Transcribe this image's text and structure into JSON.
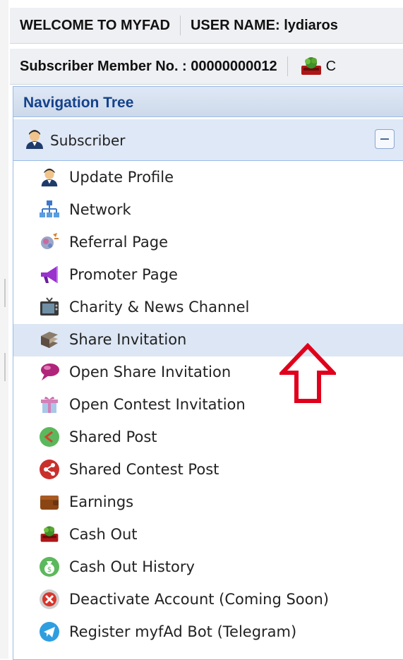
{
  "header": {
    "welcome": "WELCOME TO MYFAD",
    "username_label": "USER NAME: lydiaros",
    "subscriber_no": "Subscriber Member No. : 00000000012",
    "truncated_text": "C"
  },
  "navigation": {
    "title": "Navigation Tree",
    "root": {
      "label": "Subscriber",
      "icon": "user-icon"
    },
    "selected_item": "Share Invitation",
    "items": [
      {
        "label": "Update Profile",
        "icon": "user-icon"
      },
      {
        "label": "Network",
        "icon": "network-icon"
      },
      {
        "label": "Referral Page",
        "icon": "referral-icon"
      },
      {
        "label": "Promoter Page",
        "icon": "megaphone-icon"
      },
      {
        "label": "Charity & News Channel",
        "icon": "tv-icon"
      },
      {
        "label": "Share Invitation",
        "icon": "book-stack-icon"
      },
      {
        "label": "Open Share Invitation",
        "icon": "speech-bubble-icon"
      },
      {
        "label": "Open Contest Invitation",
        "icon": "gift-icon"
      },
      {
        "label": "Shared Post",
        "icon": "share-green-icon"
      },
      {
        "label": "Shared Contest Post",
        "icon": "share-red-icon"
      },
      {
        "label": "Earnings",
        "icon": "wallet-icon"
      },
      {
        "label": "Cash Out",
        "icon": "cash-tray-icon"
      },
      {
        "label": "Cash Out History",
        "icon": "money-bag-icon"
      },
      {
        "label": "Deactivate Account (Coming Soon)",
        "icon": "close-circle-icon"
      },
      {
        "label": "Register myfAd Bot (Telegram)",
        "icon": "telegram-icon"
      }
    ]
  },
  "colors": {
    "panel_border": "#99bbe8",
    "panel_title": "#15428b",
    "selected_row": "#dce6f4",
    "annotation_arrow": "#e0001b"
  }
}
